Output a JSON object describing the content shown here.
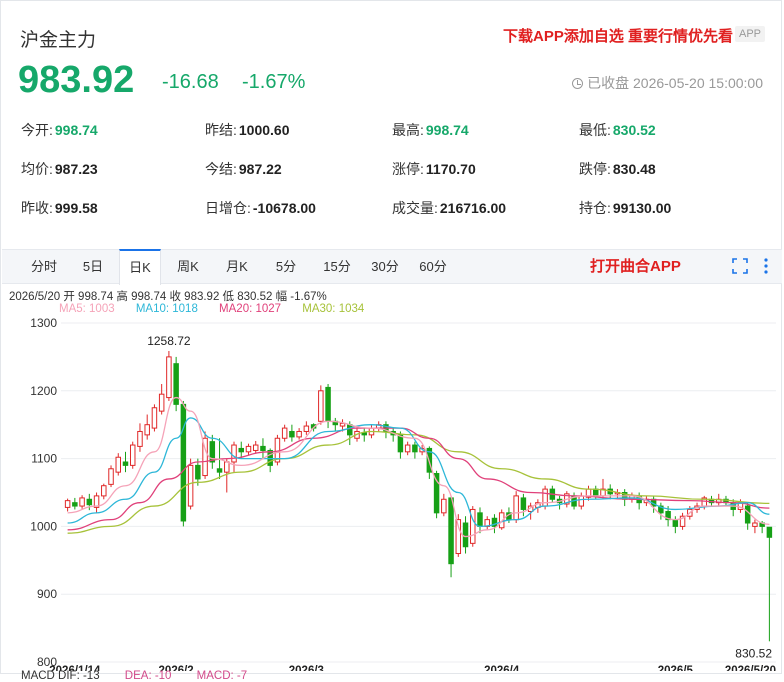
{
  "header": {
    "title": "沪金主力",
    "promo": "下载APP添加自选 重要行情优先看",
    "app_badge": "APP",
    "price": "983.92",
    "change": "-16.68",
    "change_pct": "-1.67%",
    "status": "已收盘 2026-05-20 15:00:00",
    "status_icon": "clock-icon"
  },
  "stats": [
    [
      {
        "label": "今开:",
        "value": "998.74",
        "color": "green"
      },
      {
        "label": "昨结:",
        "value": "1000.60",
        "color": ""
      },
      {
        "label": "最高:",
        "value": "998.74",
        "color": "green"
      },
      {
        "label": "最低:",
        "value": "830.52",
        "color": "green"
      }
    ],
    [
      {
        "label": "均价:",
        "value": "987.23",
        "color": ""
      },
      {
        "label": "今结:",
        "value": "987.22",
        "color": ""
      },
      {
        "label": "涨停:",
        "value": "1170.70",
        "color": ""
      },
      {
        "label": "跌停:",
        "value": "830.48",
        "color": ""
      }
    ],
    [
      {
        "label": "昨收:",
        "value": "999.58",
        "color": ""
      },
      {
        "label": "日增仓:",
        "value": "-10678.00",
        "color": ""
      },
      {
        "label": "成交量:",
        "value": "216716.00",
        "color": ""
      },
      {
        "label": "持仓:",
        "value": "99130.00",
        "color": ""
      }
    ]
  ],
  "tabs": [
    "分时",
    "5日",
    "日K",
    "周K",
    "月K",
    "5分",
    "15分",
    "30分",
    "60分"
  ],
  "active_tab": "日K",
  "tab_promo": "打开曲合APP",
  "chart_info": "2026/5/20  开 998.74  高 998.74  收 983.92  低 830.52  幅 -1.67%",
  "ma": {
    "ma5": "MA5: 1003",
    "ma10": "MA10: 1018",
    "ma20": "MA20: 1027",
    "ma30": "MA30: 1034"
  },
  "macd": {
    "dif": "MACD  DIF: -13",
    "dea": "DEA: -10",
    "macd": "MACD: -7"
  },
  "colors": {
    "up": "#e02828",
    "down": "#16a016",
    "ma5": "#f5a3b8",
    "ma10": "#2db7d8",
    "ma20": "#e0407a",
    "ma30": "#a7c23a",
    "price_green": "#16a86a",
    "promo_red": "#e02020"
  },
  "chart_data": {
    "type": "candlestick",
    "ylim": [
      800,
      1300
    ],
    "yticks": [
      1300,
      1200,
      1100,
      1000,
      900,
      800
    ],
    "xlabels": [
      "2026/1/14",
      "2026/2",
      "2026/3",
      "2026/4",
      "2026/5",
      "2026/5/20"
    ],
    "max_label": "1258.72",
    "min_label": "830.52",
    "candles": [
      [
        1028,
        1038,
        1022,
        1041
      ],
      [
        1035,
        1030,
        1025,
        1042
      ],
      [
        1030,
        1042,
        1026,
        1046
      ],
      [
        1040,
        1032,
        1024,
        1048
      ],
      [
        1028,
        1045,
        1020,
        1050
      ],
      [
        1045,
        1060,
        1040,
        1063
      ],
      [
        1062,
        1085,
        1058,
        1090
      ],
      [
        1080,
        1102,
        1075,
        1108
      ],
      [
        1095,
        1090,
        1080,
        1110
      ],
      [
        1090,
        1120,
        1085,
        1125
      ],
      [
        1118,
        1140,
        1110,
        1152
      ],
      [
        1135,
        1150,
        1128,
        1165
      ],
      [
        1145,
        1175,
        1140,
        1180
      ],
      [
        1170,
        1195,
        1165,
        1210
      ],
      [
        1190,
        1250,
        1185,
        1258.72
      ],
      [
        1240,
        1180,
        1170,
        1250
      ],
      [
        1180,
        1008,
        1000,
        1185
      ],
      [
        1030,
        1090,
        1025,
        1100
      ],
      [
        1090,
        1070,
        1060,
        1100
      ],
      [
        1075,
        1130,
        1070,
        1140
      ],
      [
        1125,
        1095,
        1085,
        1135
      ],
      [
        1085,
        1080,
        1070,
        1130
      ],
      [
        1080,
        1095,
        1050,
        1100
      ],
      [
        1095,
        1120,
        1080,
        1125
      ],
      [
        1115,
        1110,
        1100,
        1125
      ],
      [
        1110,
        1118,
        1105,
        1122
      ],
      [
        1112,
        1120,
        1108,
        1126
      ],
      [
        1118,
        1112,
        1100,
        1130
      ],
      [
        1112,
        1090,
        1080,
        1115
      ],
      [
        1095,
        1130,
        1090,
        1135
      ],
      [
        1130,
        1145,
        1125,
        1150
      ],
      [
        1140,
        1132,
        1125,
        1150
      ],
      [
        1132,
        1140,
        1128,
        1145
      ],
      [
        1140,
        1148,
        1135,
        1155
      ],
      [
        1150,
        1145,
        1140,
        1152
      ],
      [
        1155,
        1200,
        1150,
        1208
      ],
      [
        1205,
        1155,
        1145,
        1210
      ],
      [
        1155,
        1150,
        1140,
        1160
      ],
      [
        1148,
        1152,
        1140,
        1158
      ],
      [
        1150,
        1135,
        1120,
        1155
      ],
      [
        1130,
        1140,
        1125,
        1145
      ],
      [
        1138,
        1135,
        1125,
        1145
      ],
      [
        1135,
        1145,
        1130,
        1150
      ],
      [
        1145,
        1150,
        1140,
        1155
      ],
      [
        1150,
        1140,
        1130,
        1155
      ],
      [
        1140,
        1135,
        1125,
        1145
      ],
      [
        1135,
        1110,
        1100,
        1140
      ],
      [
        1110,
        1120,
        1105,
        1125
      ],
      [
        1120,
        1110,
        1100,
        1125
      ],
      [
        1110,
        1115,
        1105,
        1120
      ],
      [
        1115,
        1080,
        1070,
        1118
      ],
      [
        1078,
        1020,
        1012,
        1082
      ],
      [
        1020,
        1040,
        1015,
        1048
      ],
      [
        1042,
        945,
        925,
        1045
      ],
      [
        960,
        1010,
        955,
        1018
      ],
      [
        1005,
        970,
        960,
        1015
      ],
      [
        975,
        1025,
        970,
        1030
      ],
      [
        1020,
        1000,
        990,
        1028
      ],
      [
        1000,
        1010,
        995,
        1015
      ],
      [
        1012,
        1000,
        990,
        1018
      ],
      [
        998,
        1020,
        995,
        1025
      ],
      [
        1020,
        1010,
        1005,
        1028
      ],
      [
        1010,
        1045,
        1005,
        1052
      ],
      [
        1042,
        1025,
        1015,
        1048
      ],
      [
        1022,
        1030,
        1010,
        1035
      ],
      [
        1028,
        1035,
        1020,
        1040
      ],
      [
        1030,
        1055,
        1025,
        1060
      ],
      [
        1055,
        1040,
        1035,
        1060
      ],
      [
        1040,
        1035,
        1025,
        1045
      ],
      [
        1033,
        1048,
        1028,
        1052
      ],
      [
        1045,
        1030,
        1025,
        1050
      ],
      [
        1030,
        1045,
        1025,
        1050
      ],
      [
        1043,
        1055,
        1038,
        1060
      ],
      [
        1055,
        1045,
        1040,
        1060
      ],
      [
        1045,
        1055,
        1040,
        1070
      ],
      [
        1055,
        1048,
        1040,
        1062
      ],
      [
        1048,
        1050,
        1042,
        1055
      ],
      [
        1050,
        1040,
        1030,
        1055
      ],
      [
        1040,
        1045,
        1035,
        1050
      ],
      [
        1045,
        1035,
        1025,
        1050
      ],
      [
        1035,
        1040,
        1030,
        1045
      ],
      [
        1040,
        1030,
        1020,
        1045
      ],
      [
        1030,
        1020,
        1010,
        1035
      ],
      [
        1022,
        1010,
        1000,
        1030
      ],
      [
        1010,
        1000,
        990,
        1015
      ],
      [
        1000,
        1015,
        995,
        1020
      ],
      [
        1015,
        1025,
        1010,
        1030
      ],
      [
        1025,
        1030,
        1020,
        1035
      ],
      [
        1030,
        1042,
        1025,
        1045
      ],
      [
        1040,
        1035,
        1030,
        1045
      ],
      [
        1035,
        1040,
        1030,
        1048
      ],
      [
        1040,
        1035,
        1030,
        1045
      ],
      [
        1035,
        1025,
        1015,
        1040
      ],
      [
        1025,
        1035,
        1020,
        1040
      ],
      [
        1030,
        1005,
        995,
        1035
      ],
      [
        1000,
        1005,
        990,
        1010
      ],
      [
        1005,
        1000,
        990,
        1008
      ],
      [
        998.74,
        983.92,
        830.52,
        998.74
      ]
    ],
    "ma5": [
      [
        0,
        1020
      ],
      [
        4,
        1030
      ],
      [
        8,
        1060
      ],
      [
        12,
        1110
      ],
      [
        15,
        1190
      ],
      [
        17,
        1170
      ],
      [
        20,
        1100
      ],
      [
        24,
        1090
      ],
      [
        30,
        1110
      ],
      [
        36,
        1155
      ],
      [
        42,
        1145
      ],
      [
        48,
        1130
      ],
      [
        52,
        1060
      ],
      [
        55,
        985
      ],
      [
        58,
        995
      ],
      [
        62,
        1020
      ],
      [
        66,
        1035
      ],
      [
        72,
        1045
      ],
      [
        78,
        1045
      ],
      [
        84,
        1010
      ],
      [
        88,
        1030
      ],
      [
        92,
        1030
      ],
      [
        97,
        1003
      ]
    ],
    "ma10": [
      [
        0,
        1005
      ],
      [
        4,
        1020
      ],
      [
        8,
        1040
      ],
      [
        12,
        1080
      ],
      [
        15,
        1130
      ],
      [
        17,
        1160
      ],
      [
        20,
        1130
      ],
      [
        24,
        1100
      ],
      [
        30,
        1100
      ],
      [
        36,
        1140
      ],
      [
        42,
        1150
      ],
      [
        46,
        1145
      ],
      [
        50,
        1110
      ],
      [
        54,
        1050
      ],
      [
        57,
        1000
      ],
      [
        62,
        1010
      ],
      [
        66,
        1030
      ],
      [
        72,
        1040
      ],
      [
        78,
        1042
      ],
      [
        84,
        1025
      ],
      [
        90,
        1030
      ],
      [
        94,
        1035
      ],
      [
        97,
        1018
      ]
    ],
    "ma20": [
      [
        0,
        995
      ],
      [
        6,
        1010
      ],
      [
        10,
        1035
      ],
      [
        14,
        1070
      ],
      [
        18,
        1095
      ],
      [
        22,
        1100
      ],
      [
        28,
        1110
      ],
      [
        34,
        1130
      ],
      [
        40,
        1145
      ],
      [
        46,
        1145
      ],
      [
        50,
        1130
      ],
      [
        54,
        1100
      ],
      [
        58,
        1070
      ],
      [
        64,
        1050
      ],
      [
        70,
        1045
      ],
      [
        78,
        1040
      ],
      [
        86,
        1038
      ],
      [
        92,
        1035
      ],
      [
        97,
        1027
      ]
    ],
    "ma30": [
      [
        0,
        990
      ],
      [
        6,
        1000
      ],
      [
        12,
        1030
      ],
      [
        18,
        1065
      ],
      [
        24,
        1080
      ],
      [
        30,
        1100
      ],
      [
        36,
        1120
      ],
      [
        42,
        1140
      ],
      [
        48,
        1135
      ],
      [
        54,
        1110
      ],
      [
        60,
        1085
      ],
      [
        66,
        1070
      ],
      [
        72,
        1055
      ],
      [
        80,
        1045
      ],
      [
        88,
        1040
      ],
      [
        97,
        1034
      ]
    ]
  }
}
